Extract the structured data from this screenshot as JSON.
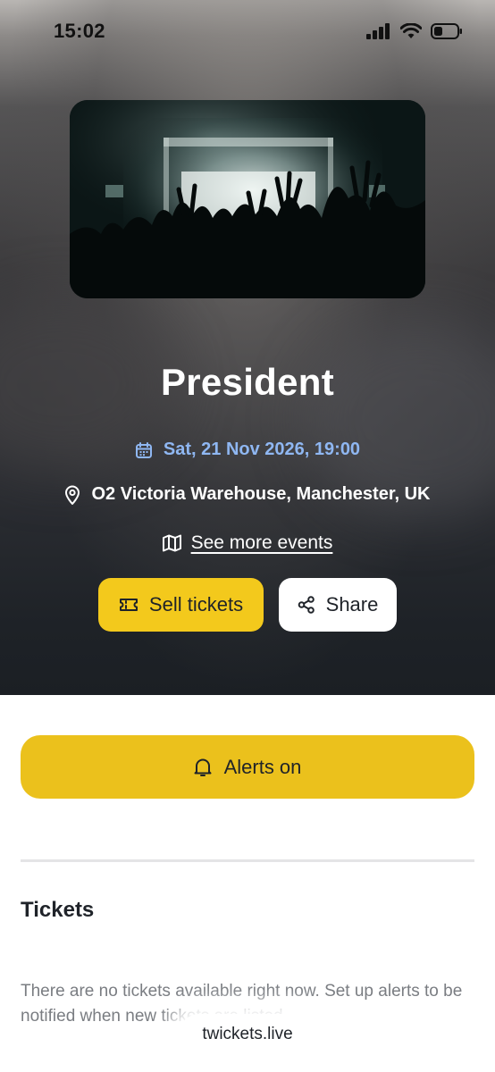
{
  "status_bar": {
    "time": "15:02"
  },
  "event": {
    "title": "President",
    "datetime": "Sat, 21 Nov 2026, 19:00",
    "venue": "O2 Victoria Warehouse, Manchester, UK",
    "more_events_label": "See more events"
  },
  "actions": {
    "sell_label": "Sell tickets",
    "share_label": "Share"
  },
  "alerts": {
    "label": "Alerts on"
  },
  "tickets": {
    "heading": "Tickets",
    "empty_message": "There are no tickets available right now. Set up alerts to be notified when new tickets are listed."
  },
  "browser": {
    "url": "twickets.live"
  },
  "colors": {
    "accent_yellow": "#f3c91c",
    "alerts_yellow": "#ebc11c",
    "date_blue": "#8fb7f2",
    "hero_dark": "#1b1f24"
  },
  "icons": {
    "calendar": "calendar-icon",
    "location": "location-pin-icon",
    "map": "map-icon",
    "ticket": "ticket-icon",
    "share": "share-icon",
    "bell": "bell-icon"
  }
}
